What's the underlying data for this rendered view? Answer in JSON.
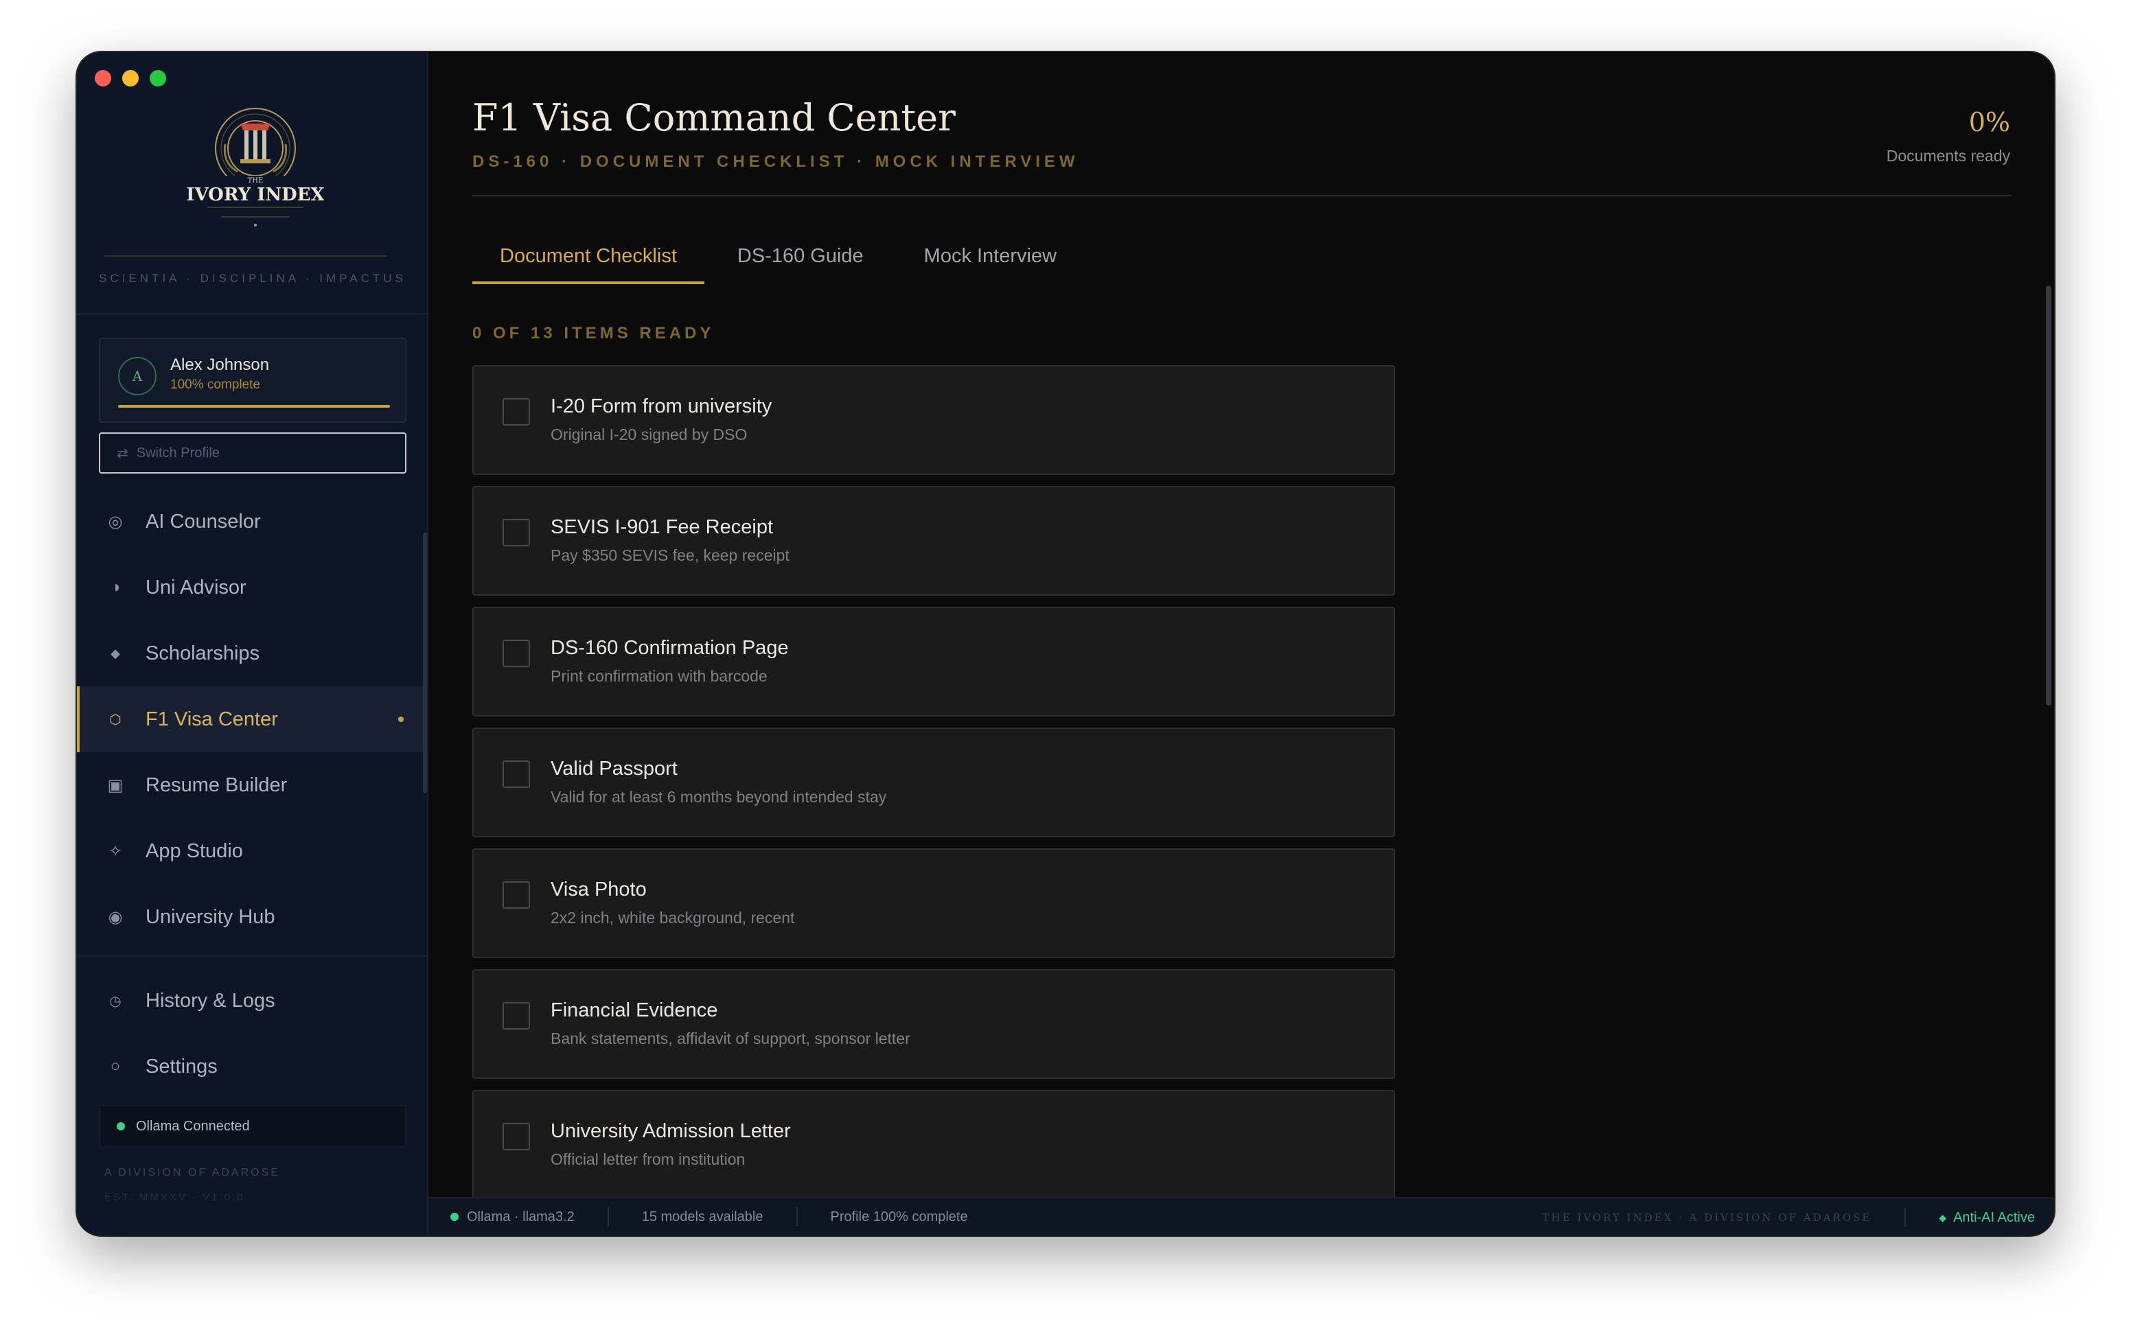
{
  "window": {
    "title": "The Ivory Index"
  },
  "brand": {
    "logo_text": "THE IVORY INDEX",
    "motto": "SCIENTIA · DISCIPLINA · IMPACTUS",
    "division": "A DIVISION OF ADAROSE",
    "est": "EST. MMXXV · V1.0.0"
  },
  "profile": {
    "initial": "A",
    "name": "Alex Johnson",
    "progress_text": "100% complete",
    "progress_fraction": 1.0,
    "switch_label": "Switch Profile"
  },
  "sidebar": {
    "items": [
      {
        "label": "AI Counselor",
        "icon": "ring-icon"
      },
      {
        "label": "Uni Advisor",
        "icon": "half-circle-icon"
      },
      {
        "label": "Scholarships",
        "icon": "diamond-icon"
      },
      {
        "label": "F1 Visa Center",
        "icon": "hexagon-icon",
        "active": true
      },
      {
        "label": "Resume Builder",
        "icon": "square-icon"
      },
      {
        "label": "App Studio",
        "icon": "sparkle-icon"
      },
      {
        "label": "University Hub",
        "icon": "target-icon"
      }
    ],
    "secondary": [
      {
        "label": "History & Logs",
        "icon": "clock-icon"
      },
      {
        "label": "Settings",
        "icon": "circle-icon"
      }
    ],
    "ollama_status": "Ollama Connected"
  },
  "header": {
    "title": "F1 Visa Command Center",
    "subtitle": "DS-160 · DOCUMENT CHECKLIST · MOCK INTERVIEW",
    "percent": "0%",
    "percent_label": "Documents ready"
  },
  "tabs": [
    {
      "label": "Document Checklist",
      "active": true
    },
    {
      "label": "DS-160 Guide"
    },
    {
      "label": "Mock Interview"
    }
  ],
  "checklist": {
    "summary": "0 OF 13 ITEMS READY",
    "items": [
      {
        "title": "I-20 Form from university",
        "desc": "Original I-20 signed by DSO",
        "checked": false
      },
      {
        "title": "SEVIS I-901 Fee Receipt",
        "desc": "Pay $350 SEVIS fee, keep receipt",
        "checked": false
      },
      {
        "title": "DS-160 Confirmation Page",
        "desc": "Print confirmation with barcode",
        "checked": false
      },
      {
        "title": "Valid Passport",
        "desc": "Valid for at least 6 months beyond intended stay",
        "checked": false
      },
      {
        "title": "Visa Photo",
        "desc": "2x2 inch, white background, recent",
        "checked": false
      },
      {
        "title": "Financial Evidence",
        "desc": "Bank statements, affidavit of support, sponsor letter",
        "checked": false
      },
      {
        "title": "University Admission Letter",
        "desc": "Official letter from institution",
        "checked": false
      }
    ]
  },
  "statusbar": {
    "model": "Ollama · llama3.2",
    "models": "15 models available",
    "profile": "Profile 100% complete",
    "brand": "THE IVORY INDEX · A DIVISION OF ADAROSE",
    "anti_ai": "Anti-AI Active"
  },
  "colors": {
    "accent_gold": "#c9a13f",
    "sidebar_bg": "#0d1626",
    "main_bg": "#0b0b0c",
    "card_bg": "#1b1b1c",
    "status_green": "#3ecf8e"
  }
}
